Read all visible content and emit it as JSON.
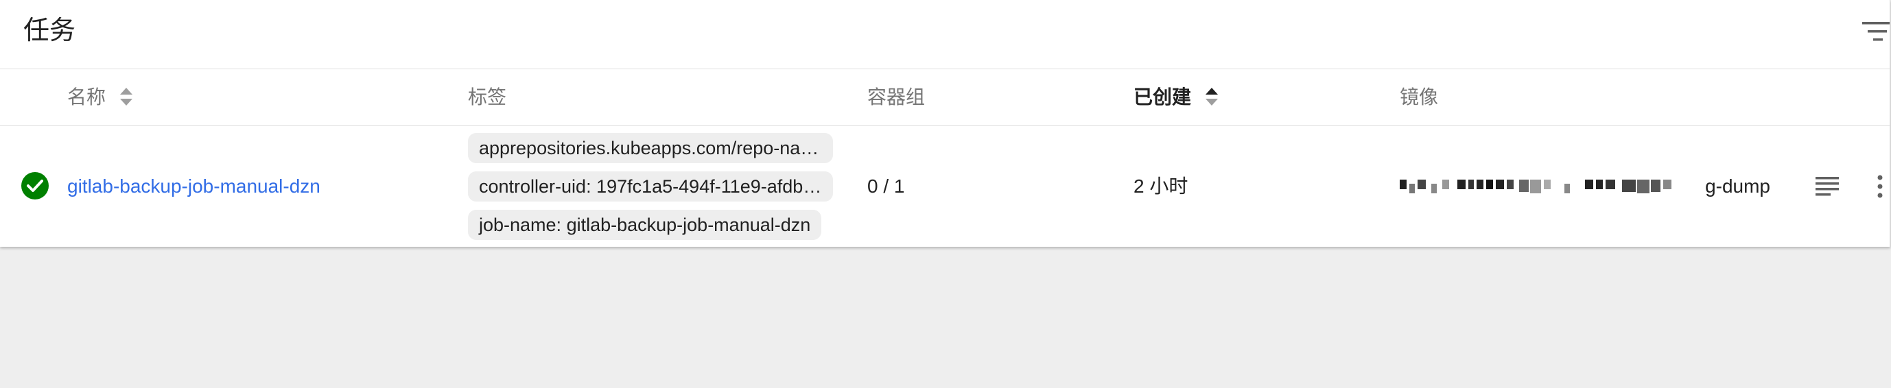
{
  "card": {
    "title": "任务"
  },
  "table": {
    "columns": [
      {
        "label": "名称",
        "sortable": true
      },
      {
        "label": "标签",
        "sortable": false
      },
      {
        "label": "容器组",
        "sortable": false
      },
      {
        "label": "已创建",
        "sortable": true,
        "active": true
      },
      {
        "label": "镜像",
        "sortable": false
      }
    ],
    "rows": [
      {
        "status": "success",
        "name": "gitlab-backup-job-manual-dzn",
        "labels": [
          "apprepositories.kubeapps.com/repo-nam...",
          "controller-uid: 197fc1a5-494f-11e9-afdb-...",
          "job-name: gitlab-backup-job-manual-dzn"
        ],
        "pods": "0 / 1",
        "created": "2 小时",
        "image_suffix": "g-dump"
      }
    ]
  },
  "icons": {
    "filter": "filter-list-icon",
    "sort": "sort-icon",
    "status": "check-circle-icon",
    "logs": "logs-icon",
    "more": "more-vert-icon"
  },
  "colors": {
    "link": "#326de6",
    "success": "#008000",
    "background": "#eeeeee"
  }
}
